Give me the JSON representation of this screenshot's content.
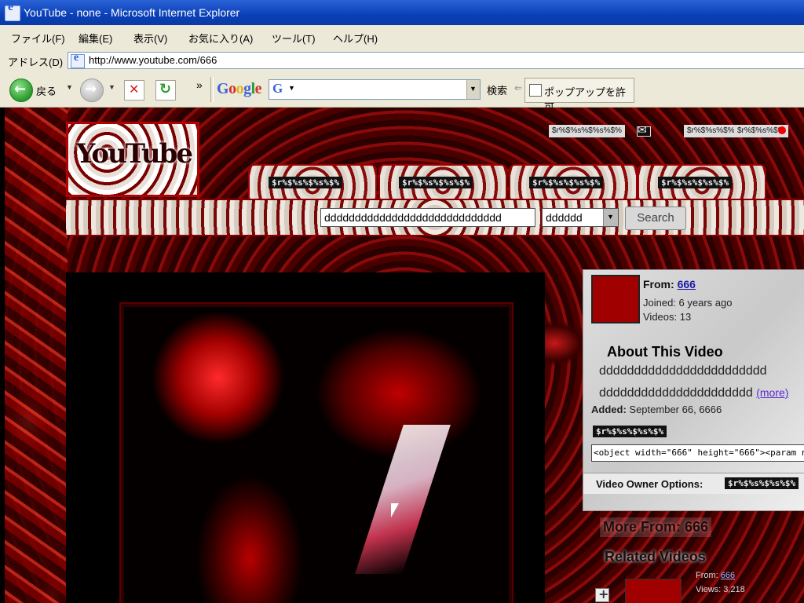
{
  "window": {
    "title": "YouTube - none - Microsoft Internet Explorer"
  },
  "menu": [
    "ファイル(F)",
    "編集(E)",
    "表示(V)",
    "お気に入り(A)",
    "ツール(T)",
    "ヘルプ(H)"
  ],
  "address": {
    "label": "アドレス(D)",
    "url": "http://www.youtube.com/666"
  },
  "toolbar": {
    "back_label": "戻る",
    "google_logo": "Google",
    "google_search_input": "",
    "search_label": "検索",
    "popup_label": "ポップアップを許可"
  },
  "page": {
    "logo_text": "YouTube",
    "header_links": [
      "$r%$%s%$%s%$%",
      "$r%$%s%$%",
      "$r%$%s%$%"
    ],
    "tabs": [
      "$r%$%s%$%s%$%",
      "$r%$%s%$%s%$%",
      "$r%$%s%$%s%$%",
      "$r%$%s%$%s%$%"
    ],
    "search": {
      "query": "ddddddddddddddddddddddddddddd",
      "scope": "dddddd",
      "button": "Search"
    },
    "info": {
      "from_label": "From:",
      "from_user": "666",
      "joined": "Joined: 6 years ago",
      "videos": "Videos: 13",
      "about_title": "About This Video",
      "desc_line1": "dddddddddddddddddddddddd",
      "desc_line2": "dddddddddddddddddddddd",
      "more_link": "(more)",
      "added_label": "Added:",
      "added_date": "September 66, 6666",
      "url_badge": "$r%$%s%$%s%$%",
      "embed_code": "<object width=\"666\" height=\"666\"><param n",
      "owner_options": "Video Owner Options:",
      "owner_badge": "$r%$%s%$%s%$%"
    },
    "more_from": "More From: 666",
    "related": "Related Videos",
    "related_item": {
      "from_label": "From:",
      "from_user": "666",
      "views": "Views: 3,218"
    }
  }
}
